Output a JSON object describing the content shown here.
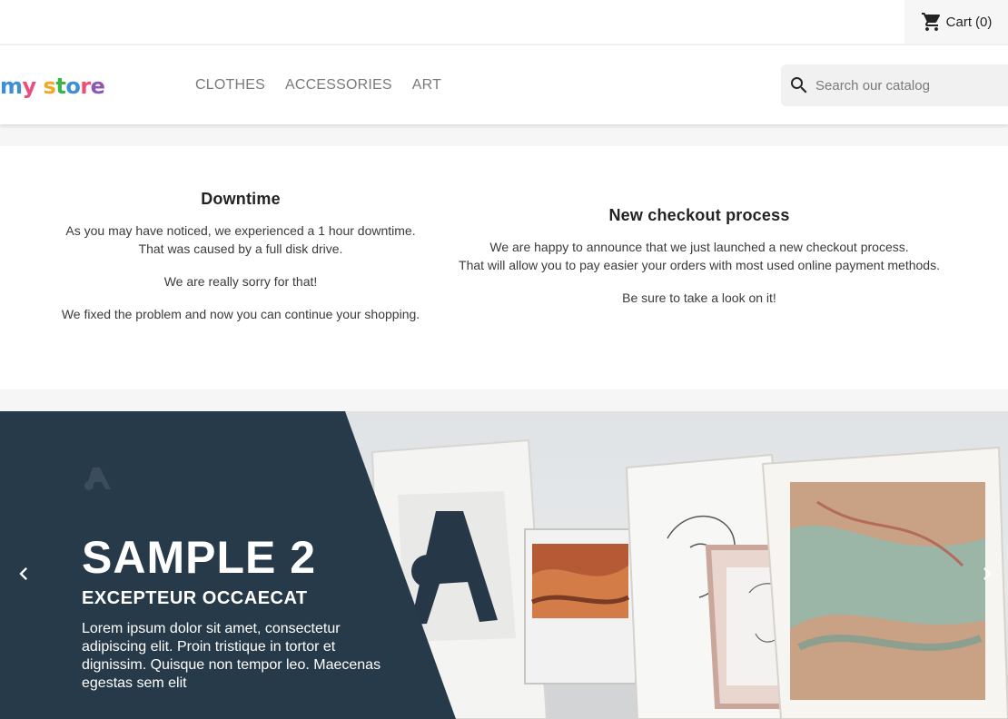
{
  "cart": {
    "label": "Cart",
    "count": "(0)"
  },
  "logo": {
    "letters": [
      "m",
      "y",
      " ",
      "s",
      "t",
      "o",
      "r",
      "e"
    ],
    "colors": [
      "#3f8fd6",
      "#eb4d7c",
      "#ffffff",
      "#f4a623",
      "#39b54a",
      "#3f8fd6",
      "#eb4d7c",
      "#8f55b5"
    ]
  },
  "nav": {
    "items": [
      "CLOTHES",
      "ACCESSORIES",
      "ART"
    ]
  },
  "search": {
    "placeholder": "Search our catalog"
  },
  "news": {
    "left": {
      "title": "Downtime",
      "p1a": "As you may have noticed, we experienced a 1 hour downtime.",
      "p1b": "That was caused by a full disk drive.",
      "p2": "We are really sorry for that!",
      "p3": "We fixed the problem and now you can continue your shopping."
    },
    "right": {
      "title": "New checkout process",
      "p1a": "We are happy to announce that we just launched a new checkout process.",
      "p1b": "That will allow you to pay easier your orders with most used online payment methods.",
      "p2": "Be sure to take a look on it!"
    }
  },
  "slide": {
    "title": "SAMPLE 2",
    "subtitle": "EXCEPTEUR OCCAECAT",
    "body": "Lorem ipsum dolor sit amet, consectetur adipiscing elit. Proin tristique in tortor et dignissim. Quisque non tempor leo. Maecenas egestas sem elit"
  },
  "colors": {
    "panel": "#263a4a",
    "accent": "#24b9d7"
  }
}
